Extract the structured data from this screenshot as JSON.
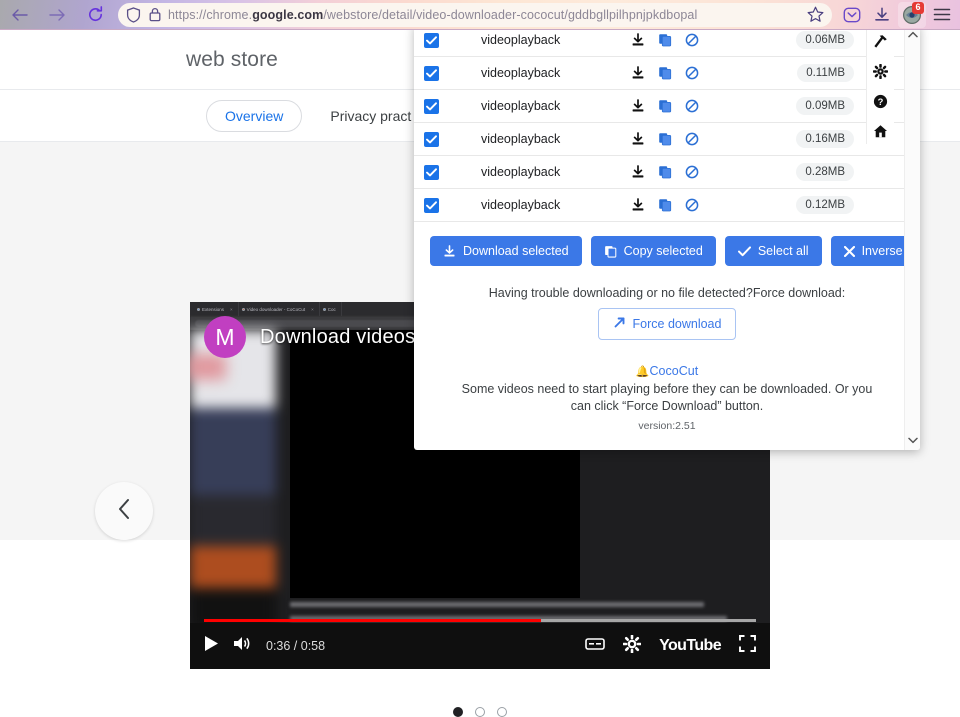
{
  "browser": {
    "back_icon": "arrow-left-icon",
    "forward_icon": "arrow-right-icon",
    "reload_icon": "reload-icon",
    "shield_icon": "shield-icon",
    "lock_icon": "lock-icon",
    "url_prefix": "https://chrome.",
    "url_domain": "google.com",
    "url_suffix": "/webstore/detail/video-downloader-cococut/gddbgllpilhpnjpkdbopal",
    "bookmark_icon": "star-icon",
    "pocket_icon": "pocket-icon",
    "downloads_icon": "download-icon",
    "extension_icon": "extension-icon",
    "extension_badge": "6",
    "menu_icon": "hamburger-menu-icon"
  },
  "store": {
    "title": "web store",
    "tabs": [
      {
        "label": "Overview",
        "active": true
      },
      {
        "label": "Privacy pract",
        "active": false
      }
    ],
    "carousel": {
      "prev_icon": "chevron-left-icon",
      "dots": [
        true,
        false,
        false
      ]
    },
    "video": {
      "avatar_letter": "M",
      "overlay_title": "Download videos from",
      "shot_tabs": [
        "Extensions",
        "Video downloader - CoCoCut",
        "Coc"
      ],
      "time": "0:36 / 0:58",
      "progress_percent": 61,
      "play_icon": "play-icon",
      "volume_icon": "volume-icon",
      "cc_icon": "closed-captions-icon",
      "settings_icon": "gear-icon",
      "logo": "YouTube",
      "fullscreen_icon": "fullscreen-icon"
    }
  },
  "popup": {
    "files": [
      {
        "name": "videoplayback",
        "size": "0.06MB",
        "checked": true
      },
      {
        "name": "videoplayback",
        "size": "0.11MB",
        "checked": true
      },
      {
        "name": "videoplayback",
        "size": "0.09MB",
        "checked": true
      },
      {
        "name": "videoplayback",
        "size": "0.16MB",
        "checked": true
      },
      {
        "name": "videoplayback",
        "size": "0.28MB",
        "checked": true
      },
      {
        "name": "videoplayback",
        "size": "0.12MB",
        "checked": true
      }
    ],
    "row_icons": {
      "download": "download-icon",
      "copy": "copy-icon",
      "block": "block-icon"
    },
    "buttons": [
      {
        "label": "Download selected",
        "icon": "download-icon"
      },
      {
        "label": "Copy selected",
        "icon": "copy-icon"
      },
      {
        "label": "Select all",
        "icon": "check-icon"
      },
      {
        "label": "Inverse selection",
        "icon": "close-x-icon"
      }
    ],
    "hint": "Having trouble downloading or no file detected?Force download:",
    "force_button": {
      "label": "Force download",
      "icon": "arrow-up-right-icon"
    },
    "brand": {
      "bell": "🔔",
      "name": "CocoCut"
    },
    "description": "Some videos need to start playing before they can be downloaded. Or you can click “Force Download” button.",
    "version": "version:2.51",
    "rail_icons": [
      "hammer-icon",
      "gear-icon",
      "help-icon",
      "home-icon"
    ],
    "scroll_up_icon": "chevron-up-icon",
    "scroll_down_icon": "chevron-down-icon"
  },
  "colors": {
    "accent_blue": "#3b78e7",
    "checkbox_blue": "#1a73e8",
    "progress_red": "#ff0000",
    "avatar_purple": "#c13fc1",
    "badge_red": "#e53935"
  }
}
